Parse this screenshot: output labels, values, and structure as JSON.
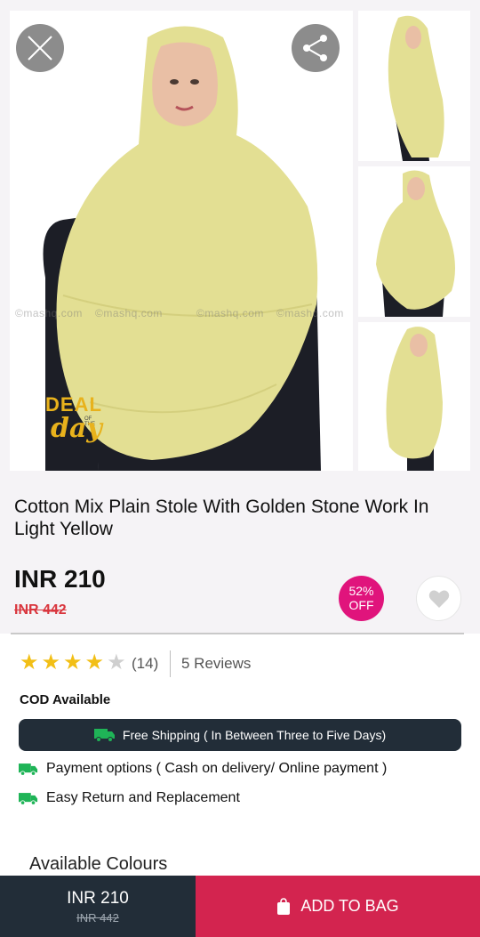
{
  "gallery": {
    "watermark_text": "©mashq.com",
    "deal_badge": {
      "word": "DEAL",
      "of_the": "OF THE",
      "day": "day"
    }
  },
  "colors": {
    "model_skin": "#e9bfa5",
    "stole": "#e3df93",
    "black_dress": "#1c1e26",
    "deal_gold": "#e8b21c",
    "accent_pink": "#e0147c",
    "dark_navy": "#222d38",
    "bag_red": "#d3244f",
    "star_gold": "#f2bf16",
    "price_red": "#d9363e",
    "ship_green": "#1fb457"
  },
  "product": {
    "title": "Cotton Mix Plain Stole With Golden Stone Work In Light Yellow",
    "price": "INR 210",
    "mrp": "INR 442",
    "discount_percent": "52%",
    "discount_label": "OFF"
  },
  "rating": {
    "stars": 4,
    "max_stars": 5,
    "count": "(14)",
    "reviews_label": "5 Reviews"
  },
  "delivery": {
    "cod": "COD Available",
    "shipping": "Free Shipping ( In Between Three to Five Days)",
    "payment": "Payment options ( Cash on delivery/ Online payment )",
    "returns": "Easy Return and Replacement"
  },
  "colours_heading": "Available Colours",
  "bottom_bar": {
    "price": "INR 210",
    "mrp": "INR 442",
    "add_to_bag": "ADD TO BAG"
  },
  "icons": {
    "close": "close-icon",
    "share": "share-icon",
    "wishlist": "heart-icon",
    "truck": "truck-icon",
    "bag": "shopping-bag-icon"
  }
}
